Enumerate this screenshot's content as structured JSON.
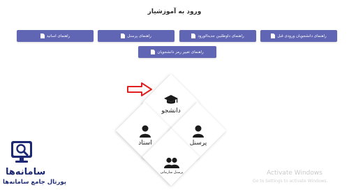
{
  "page": {
    "title": "ورود به آموزشیار"
  },
  "guide_buttons": [
    {
      "label": "راهنمای دانشجویان ورودی قبل"
    },
    {
      "label": "راهنمای داوطلبین جدیدالورود"
    },
    {
      "label": "راهنمای پرسنل"
    },
    {
      "label": "راهنمای اساتید"
    },
    {
      "label": "راهنمای تغییر رمز دانشجویان"
    }
  ],
  "login_tiles": {
    "student": "دانشجو",
    "staff": "پرسنل",
    "professor": "استاد",
    "org_staff": "پرسنل سازمانی"
  },
  "icons": {
    "button_icon": "document-icon",
    "student": "graduation-cap-icon",
    "staff": "user-icon",
    "professor": "user-icon",
    "org_staff": "users-icon",
    "pointer": "red-arrow-icon"
  },
  "branding": {
    "name": "سامانه‌ها",
    "tagline": "پورتال جامع سامانه‌ها"
  },
  "windows_watermark": {
    "title": "Activate Windows",
    "subtitle": "Go to Settings to activate Windows."
  },
  "colors": {
    "button_bg": "#6065b4",
    "arrow": "#e02020",
    "brand": "#1d2a73"
  }
}
